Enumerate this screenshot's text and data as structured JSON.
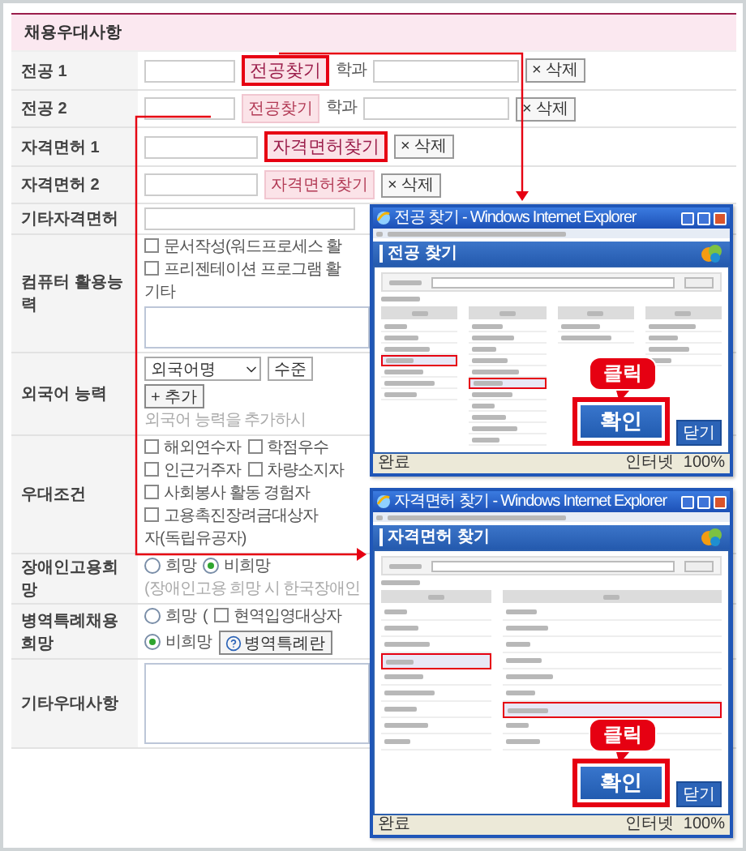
{
  "section_title": "채용우대사항",
  "majors": [
    {
      "label": "전공 1",
      "find": "전공찾기",
      "highlighted": true,
      "dept": "학과",
      "delete": "× 삭제"
    },
    {
      "label": "전공 2",
      "find": "전공찾기",
      "highlighted": false,
      "dept": "학과",
      "delete": "× 삭제"
    }
  ],
  "licenses": [
    {
      "label": "자격면허 1",
      "find": "자격면허찾기",
      "highlighted": true,
      "delete": "× 삭제"
    },
    {
      "label": "자격면허 2",
      "find": "자격면허찾기",
      "highlighted": false,
      "delete": "× 삭제"
    }
  ],
  "other_license": {
    "label": "기타자격면허"
  },
  "computer": {
    "label": "컴퓨터 활용능력",
    "options": [
      {
        "text": "문서작성(워드프로세스 활",
        "checked": false
      },
      {
        "text": "프리젠테이션 프로그램 활",
        "checked": false
      }
    ],
    "other_label": "기타"
  },
  "language": {
    "label": "외국어 능력",
    "language_select": "외국어명",
    "level_select": "수준",
    "add_button": "+ 추가",
    "hint": "외국어 능력을 추가하시"
  },
  "preferences": {
    "label": "우대조건",
    "options": [
      {
        "text": "해외연수자",
        "checked": false
      },
      {
        "text": "학점우수",
        "checked": false
      },
      {
        "text": "인근거주자",
        "checked": false
      },
      {
        "text": "차량소지자",
        "checked": false
      },
      {
        "text": "사회봉사 활동 경험자",
        "checked": false
      },
      {
        "text": "고용촉진장려금대상자",
        "checked": false
      }
    ],
    "continuation": "자(독립유공자)"
  },
  "disabled_hiring": {
    "label": "장애인고용희망",
    "options": [
      {
        "text": "희망",
        "selected": false
      },
      {
        "text": "비희망",
        "selected": true
      }
    ],
    "hint": "(장애인고용 희망 시 한국장애인"
  },
  "military": {
    "label": "병역특례채용희망",
    "options": [
      {
        "text": "희망",
        "selected": false
      },
      {
        "text": "비희망",
        "selected": true
      }
    ],
    "paren": "(",
    "sub_option": {
      "text": "현역입영대상자",
      "checked": false
    },
    "guide_button": "병역특례란"
  },
  "other_preferences": {
    "label": "기타우대사항"
  },
  "popups": [
    {
      "title": "전공 찾기 - Windows Internet Explorer",
      "heading": "전공 찾기",
      "confirm": "확인",
      "close": "닫기",
      "callout": "클릭",
      "status": [
        "완료",
        "인터넷",
        "100%"
      ],
      "columns": [
        {
          "items": [
            {
              "selected": false
            },
            {
              "selected": false
            },
            {
              "selected": false
            },
            {
              "selected": true
            },
            {
              "selected": false
            },
            {
              "selected": false
            },
            {
              "selected": false
            }
          ]
        },
        {
          "items": [
            {
              "selected": false
            },
            {
              "selected": false
            },
            {
              "selected": false
            },
            {
              "selected": false
            },
            {
              "selected": false
            },
            {
              "selected": true
            },
            {
              "selected": false
            },
            {
              "selected": false
            },
            {
              "selected": false
            },
            {
              "selected": false
            },
            {
              "selected": false
            }
          ]
        },
        {
          "items": [
            {
              "selected": false
            },
            {
              "selected": false
            }
          ]
        },
        {
          "items": [
            {
              "selected": false
            },
            {
              "selected": false
            },
            {
              "selected": false
            },
            {
              "selected": false
            }
          ]
        }
      ]
    },
    {
      "title": "자격면허 찾기 - Windows Internet Explorer",
      "heading": "자격면허 찾기",
      "confirm": "확인",
      "close": "닫기",
      "callout": "클릭",
      "status": [
        "완료",
        "인터넷",
        "100%"
      ],
      "columns": [
        {
          "items": [
            {
              "selected": false
            },
            {
              "selected": false
            },
            {
              "selected": false
            },
            {
              "selected": true
            },
            {
              "selected": false
            },
            {
              "selected": false
            },
            {
              "selected": false
            },
            {
              "selected": false
            },
            {
              "selected": false
            }
          ]
        },
        {
          "items": [
            {
              "selected": false
            },
            {
              "selected": false
            },
            {
              "selected": false
            },
            {
              "selected": false
            },
            {
              "selected": false
            },
            {
              "selected": false
            },
            {
              "selected": true
            },
            {
              "selected": false
            },
            {
              "selected": false
            }
          ]
        }
      ]
    }
  ]
}
